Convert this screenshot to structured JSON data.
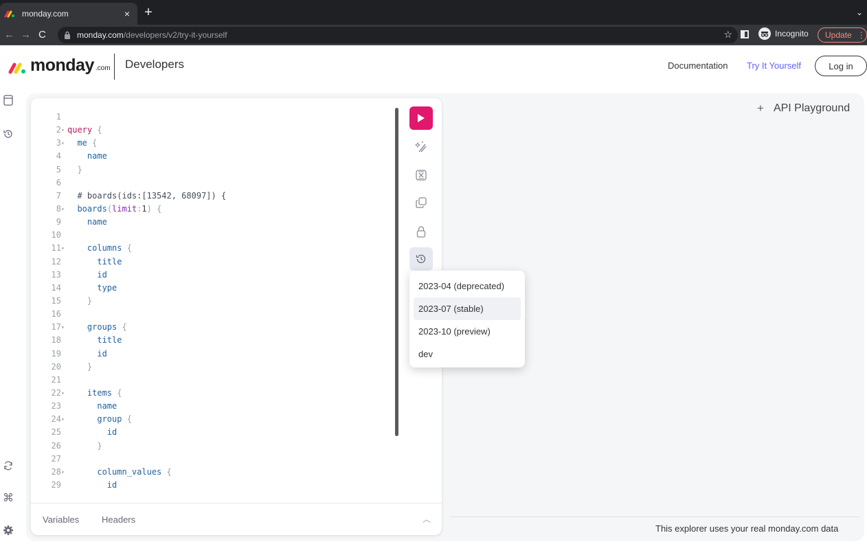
{
  "browser": {
    "tab_title": "monday.com",
    "tab_close": "×",
    "new_tab": "+",
    "url_host": "monday.com",
    "url_path": "/developers/v2/try-it-yourself",
    "incognito_label": "Incognito",
    "update_label": "Update",
    "accent_update": "#f28b82"
  },
  "header": {
    "logo_text": "monday",
    "logo_suffix": ".com",
    "brand_sub": "Developers",
    "nav_documentation": "Documentation",
    "nav_try": "Try It Yourself",
    "login": "Log in",
    "accent": "#6161ff"
  },
  "editor": {
    "lines": [
      {
        "n": "1",
        "fold": false,
        "code": ""
      },
      {
        "n": "2",
        "fold": true,
        "code": "query {"
      },
      {
        "n": "3",
        "fold": true,
        "code": "  me {"
      },
      {
        "n": "4",
        "fold": false,
        "code": "    name"
      },
      {
        "n": "5",
        "fold": false,
        "code": "  }"
      },
      {
        "n": "6",
        "fold": false,
        "code": ""
      },
      {
        "n": "7",
        "fold": false,
        "code": "  # boards(ids:[13542, 68097]) {"
      },
      {
        "n": "8",
        "fold": true,
        "code": "  boards(limit:1) {"
      },
      {
        "n": "9",
        "fold": false,
        "code": "    name"
      },
      {
        "n": "10",
        "fold": false,
        "code": ""
      },
      {
        "n": "11",
        "fold": true,
        "code": "    columns {"
      },
      {
        "n": "12",
        "fold": false,
        "code": "      title"
      },
      {
        "n": "13",
        "fold": false,
        "code": "      id"
      },
      {
        "n": "14",
        "fold": false,
        "code": "      type"
      },
      {
        "n": "15",
        "fold": false,
        "code": "    }"
      },
      {
        "n": "16",
        "fold": false,
        "code": ""
      },
      {
        "n": "17",
        "fold": true,
        "code": "    groups {"
      },
      {
        "n": "18",
        "fold": false,
        "code": "      title"
      },
      {
        "n": "19",
        "fold": false,
        "code": "      id"
      },
      {
        "n": "20",
        "fold": false,
        "code": "    }"
      },
      {
        "n": "21",
        "fold": false,
        "code": ""
      },
      {
        "n": "22",
        "fold": true,
        "code": "    items {"
      },
      {
        "n": "23",
        "fold": false,
        "code": "      name"
      },
      {
        "n": "24",
        "fold": true,
        "code": "      group {"
      },
      {
        "n": "25",
        "fold": false,
        "code": "        id"
      },
      {
        "n": "26",
        "fold": false,
        "code": "      }"
      },
      {
        "n": "27",
        "fold": false,
        "code": ""
      },
      {
        "n": "28",
        "fold": true,
        "code": "      column_values {"
      },
      {
        "n": "29",
        "fold": false,
        "code": "        id"
      }
    ],
    "footer_variables": "Variables",
    "footer_headers": "Headers",
    "run_color": "#e2176e"
  },
  "tools": [
    "play-icon",
    "prettify-icon",
    "merge-icon",
    "copy-icon",
    "lock-icon",
    "history-icon"
  ],
  "versions": {
    "items": [
      "2023-04 (deprecated)",
      "2023-07 (stable)",
      "2023-10 (preview)",
      "dev"
    ],
    "selected": "2023-07 (stable)"
  },
  "right": {
    "playground_plus": "+",
    "playground_title": "API Playground",
    "note": "This explorer uses your real monday.com data"
  }
}
